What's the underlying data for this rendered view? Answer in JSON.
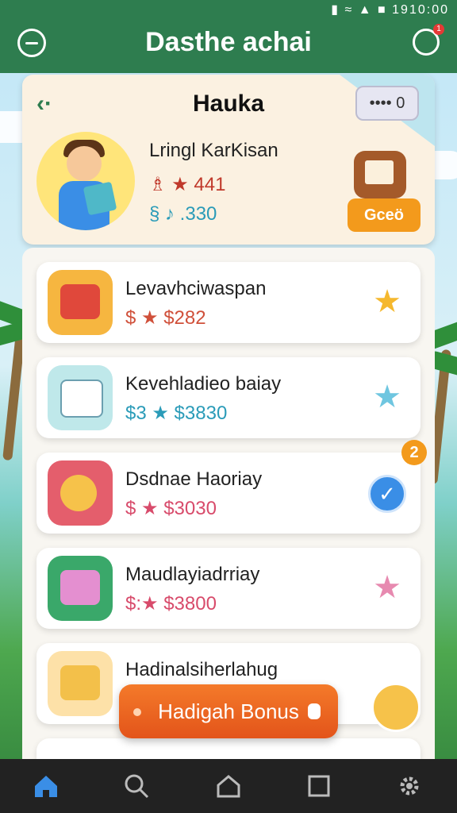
{
  "status_bar": {
    "time": "1910:00",
    "icons": [
      "sim-icon",
      "wifi-icon",
      "signal-icon",
      "battery-icon"
    ]
  },
  "header": {
    "title": "Dasthe achai",
    "notification_count": "1",
    "colors": {
      "primary": "#2e7d4f"
    }
  },
  "profile": {
    "card_title": "Hauka",
    "more_label": "•••• 0",
    "name": "Lringl KarKisan",
    "stat_one": "♗ ★ 441",
    "stat_two": "§ ♪ .330",
    "action_label": "Gceö"
  },
  "list": [
    {
      "title": "Levavhciwaspan",
      "meta": "$ ★ $282",
      "meta_color": "#d0503a",
      "right_icon": "star-icon",
      "right_color": "#f5b82e"
    },
    {
      "title": "Kevehladieo baiay",
      "meta": "$3 ★ $3830",
      "meta_color": "#2a9bb8",
      "right_icon": "star-icon",
      "right_color": "#6fc6e0"
    },
    {
      "title": "Dsdnae Haoriay",
      "meta": "$ ★ $3030",
      "meta_color": "#d84b6b",
      "right_icon": "check-icon",
      "badge": "2"
    },
    {
      "title": "Maudlayiadrriay",
      "meta": "$:★ $3800",
      "meta_color": "#d84b6b",
      "right_icon": "star-icon",
      "right_color": "#e78ab0"
    },
    {
      "title": "Hadinalsiherlahug",
      "meta": "",
      "right_icon": "gift-icon"
    }
  ],
  "bonus_button": "Hadigah Bonus",
  "bottom_nav": [
    "home-icon",
    "search-icon",
    "house-outline-icon",
    "square-icon",
    "settings-icon"
  ]
}
